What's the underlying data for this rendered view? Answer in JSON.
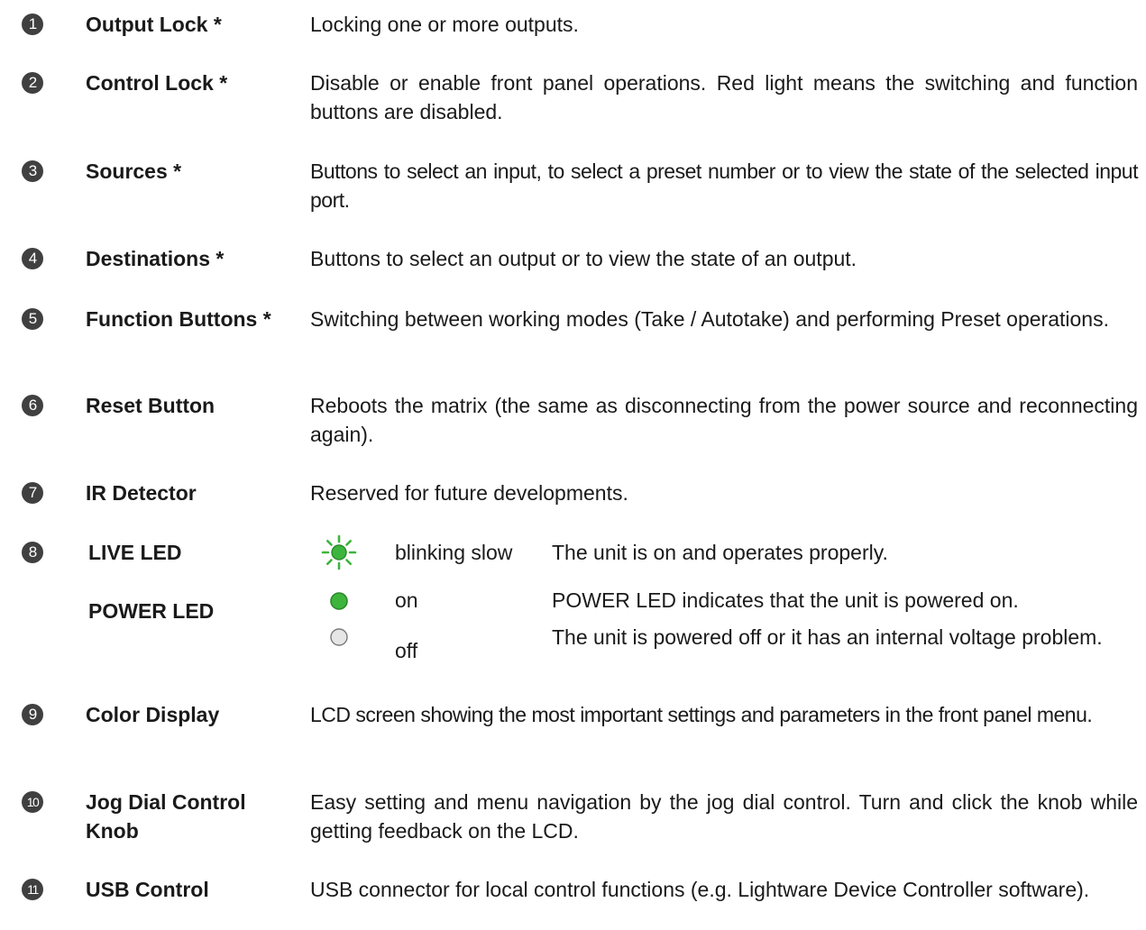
{
  "items": [
    {
      "num": "1",
      "term": "Output Lock *",
      "desc": "Locking one or more outputs."
    },
    {
      "num": "2",
      "term": "Control Lock *",
      "desc": "Disable or enable front panel operations. Red light means the switching and function buttons are disabled."
    },
    {
      "num": "3",
      "term": "Sources *",
      "desc": "Buttons to select an input, to select a preset number or to view the state of the selected input port."
    },
    {
      "num": "4",
      "term": "Destinations *",
      "desc": "Buttons to select an output or to view the state of an output."
    },
    {
      "num": "5",
      "term": "Function Buttons *",
      "desc": "Switching between working modes (Take / Autotake) and performing Preset operations."
    },
    {
      "num": "6",
      "term": "Reset Button",
      "desc": "Reboots the matrix (the same as disconnecting from the power source and reconnecting again)."
    },
    {
      "num": "7",
      "term": "IR Detector",
      "desc": "Reserved for future developments."
    },
    {
      "num": "8",
      "term": "",
      "desc": ""
    },
    {
      "num": "9",
      "term": "Color Display",
      "desc": "LCD screen showing the most important settings and parameters in the front panel menu."
    },
    {
      "num": "10",
      "term": "Jog Dial Control Knob",
      "desc": "Easy setting and menu navigation by the jog dial control. Turn and click the knob while getting feedback on the LCD."
    },
    {
      "num": "11",
      "term": "USB Control",
      "desc": "USB connector for local control functions (e.g. Lightware Device Controller software)."
    }
  ],
  "leds": {
    "live": {
      "name": "LIVE LED",
      "state": "blinking slow",
      "text": "The unit is on and operates properly.",
      "color": "#3db53d"
    },
    "power": {
      "name": "POWER LED",
      "on_state": "on",
      "on_text": "POWER LED indicates that the unit is powered on.",
      "on_color": "#3db53d",
      "off_state": "off",
      "off_text": "The unit is powered off or it has an internal voltage problem.",
      "off_color": "#e6e6e6"
    }
  },
  "colors": {
    "badge": "#404040",
    "text": "#1a1a1a",
    "led_green": "#3db53d"
  }
}
